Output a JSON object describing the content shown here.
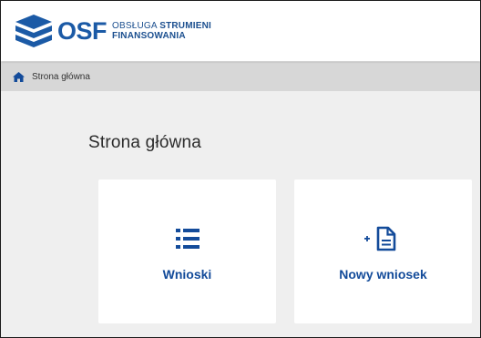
{
  "header": {
    "logo_text": "OSF",
    "logo_subtitle_line1_light": "OBSŁUGA ",
    "logo_subtitle_line1_strong": "STRUMIENI",
    "logo_subtitle_line2": "FINANSOWANIA"
  },
  "breadcrumb": {
    "icon": "home-icon",
    "items": [
      "Strona główna"
    ]
  },
  "main": {
    "title": "Strona główna",
    "tiles": [
      {
        "label": "Wnioski",
        "icon": "list-icon"
      },
      {
        "label": "Nowy wniosek",
        "icon": "new-document-icon"
      }
    ]
  },
  "colors": {
    "brand": "#1b5aa6",
    "tile_label": "#134b9a",
    "background": "#efefef",
    "breadcrumb_bg": "#d7d7d7"
  }
}
